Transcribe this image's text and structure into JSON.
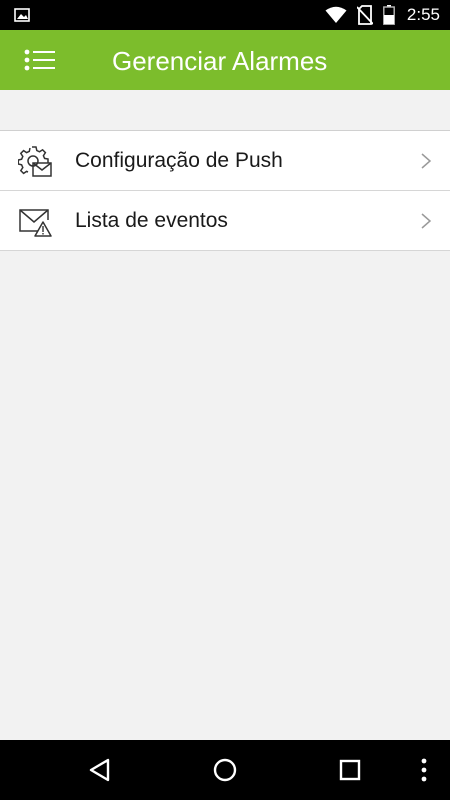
{
  "status_bar": {
    "time": "2:55",
    "icons": [
      "image-notification-icon",
      "wifi-icon",
      "no-sim-icon",
      "battery-icon"
    ]
  },
  "app_bar": {
    "title": "Gerenciar Alarmes",
    "menu_icon": "menu-list-icon",
    "color": "#7cbd2c"
  },
  "menu": {
    "items": [
      {
        "label": "Configuração de Push",
        "icon": "gear-mail-icon"
      },
      {
        "label": "Lista de eventos",
        "icon": "mail-warning-icon"
      }
    ]
  },
  "nav_bar": {
    "buttons": [
      "back-icon",
      "home-icon",
      "recents-icon",
      "more-vert-icon"
    ]
  }
}
